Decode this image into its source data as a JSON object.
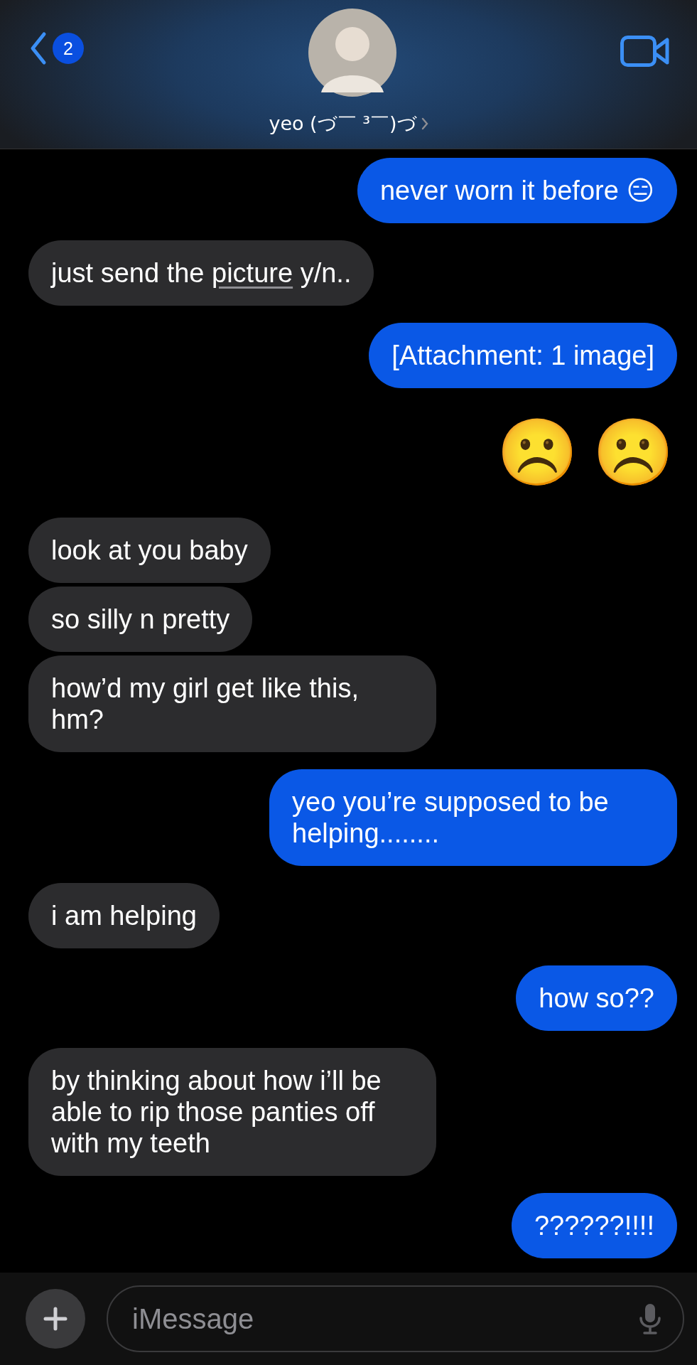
{
  "header": {
    "back_badge": "2",
    "contact_name": "yeo (づ￣ ³￣)づ"
  },
  "messages": [
    {
      "outgoing": true,
      "kind": "text",
      "text": "never worn it before 😑"
    },
    {
      "outgoing": false,
      "kind": "text",
      "parts": [
        {
          "text": "just send the ",
          "underlined": false
        },
        {
          "text": "picture",
          "underlined": true
        },
        {
          "text": " y/n..",
          "underlined": false
        }
      ]
    },
    {
      "outgoing": true,
      "kind": "text",
      "text": "[Attachment: 1 image]"
    },
    {
      "outgoing": true,
      "kind": "emoji",
      "emoji": [
        "☹️",
        "☹️"
      ]
    },
    {
      "outgoing": false,
      "kind": "text",
      "text": "look at you baby"
    },
    {
      "outgoing": false,
      "kind": "text",
      "text": "so silly n pretty"
    },
    {
      "outgoing": false,
      "kind": "text",
      "text": "how’d my girl get like this, hm?"
    },
    {
      "outgoing": true,
      "kind": "text",
      "text": "yeo you’re supposed to be helping........"
    },
    {
      "outgoing": false,
      "kind": "text",
      "text": "i am helping"
    },
    {
      "outgoing": true,
      "kind": "text",
      "text": "how so??"
    },
    {
      "outgoing": false,
      "kind": "text",
      "text": "by thinking about how i’ll be able to rip those panties off with my teeth"
    },
    {
      "outgoing": true,
      "kind": "text",
      "text": "??????!!!!"
    }
  ],
  "composer": {
    "placeholder": "iMessage"
  }
}
